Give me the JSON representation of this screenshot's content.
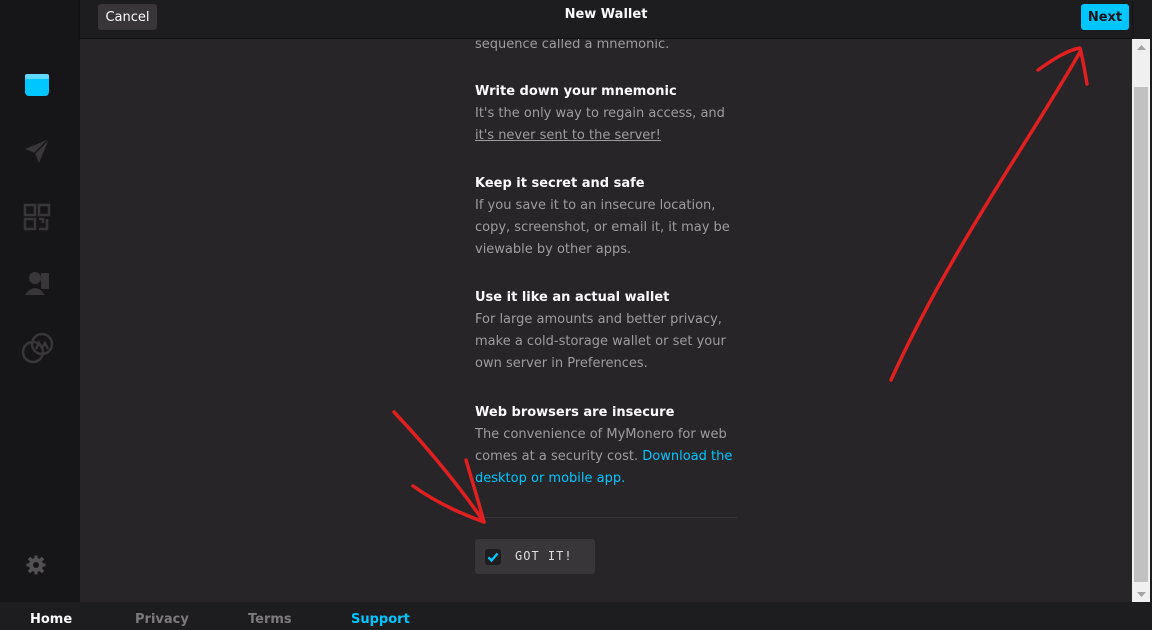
{
  "header": {
    "title": "New Wallet",
    "cancel_label": "Cancel",
    "next_label": "Next"
  },
  "sidebar": {
    "items": [
      {
        "icon": "wallets-icon",
        "active": true
      },
      {
        "icon": "send-icon"
      },
      {
        "icon": "qr-code-icon"
      },
      {
        "icon": "contacts-icon"
      },
      {
        "icon": "exchange-icon"
      }
    ],
    "settings_icon": "gear-icon"
  },
  "main": {
    "clipped_text": "sequence called a mnemonic.",
    "sections": [
      {
        "title": "Write down your mnemonic",
        "body_prefix": "It's the only way to regain access, and ",
        "body_underlined": "it's never sent to the server!"
      },
      {
        "title": "Keep it secret and safe",
        "body": "If you save it to an insecure location, copy, screenshot, or email it, it may be viewable by other apps."
      },
      {
        "title": "Use it like an actual wallet",
        "body": "For large amounts and better privacy, make a cold-storage wallet or set your own server in Preferences."
      },
      {
        "title": "Web browsers are insecure",
        "body_prefix": "The convenience of MyMonero for web comes at a security cost. ",
        "body_link": "Download the desktop or mobile app",
        "body_suffix": "."
      }
    ],
    "checkbox_label": "GOT IT!",
    "checkbox_checked": true
  },
  "footer": {
    "nav": [
      "Home",
      "Privacy",
      "Terms",
      "Support"
    ],
    "active": "Home"
  },
  "colors": {
    "accent": "#00c6ff",
    "background": "#272527",
    "annotation": "#e02020"
  }
}
